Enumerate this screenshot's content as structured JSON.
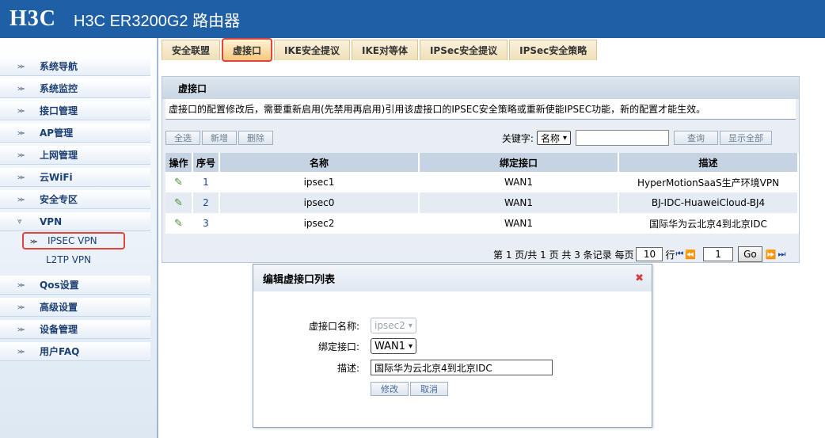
{
  "header": {
    "logo": "H3C",
    "title": "H3C ER3200G2 路由器"
  },
  "sidebar": {
    "items": [
      {
        "label": "系统导航"
      },
      {
        "label": "系统监控"
      },
      {
        "label": "接口管理"
      },
      {
        "label": "AP管理"
      },
      {
        "label": "上网管理"
      },
      {
        "label": "云WiFi"
      },
      {
        "label": "安全专区"
      },
      {
        "label": "VPN"
      },
      {
        "label": "Qos设置"
      },
      {
        "label": "高级设置"
      },
      {
        "label": "设备管理"
      },
      {
        "label": "用户FAQ"
      }
    ],
    "vpn_sub": [
      {
        "label": "IPSEC VPN"
      },
      {
        "label": "L2TP VPN"
      }
    ]
  },
  "tabs": [
    {
      "label": "安全联盟"
    },
    {
      "label": "虚接口"
    },
    {
      "label": "IKE安全提议"
    },
    {
      "label": "IKE对等体"
    },
    {
      "label": "IPSec安全提议"
    },
    {
      "label": "IPSec安全策略"
    }
  ],
  "panel": {
    "title": "虚接口",
    "notice": "虚接口的配置修改后，需要重新启用(先禁用再启用)引用该虚接口的IPSEC安全策略或重新使能IPSEC功能，新的配置才能生效。",
    "toolbar": {
      "select_all": "全选",
      "add": "新增",
      "delete": "删除",
      "keyword_label": "关键字:",
      "keyword_field": "名称",
      "query": "查询",
      "show_all": "显示全部"
    },
    "table": {
      "headers": [
        "操作",
        "序号",
        "名称",
        "绑定接口",
        "描述"
      ],
      "rows": [
        {
          "seq": "1",
          "name": "ipsec1",
          "iface": "WAN1",
          "desc": "HyperMotionSaaS生产环境VPN"
        },
        {
          "seq": "2",
          "name": "ipsec0",
          "iface": "WAN1",
          "desc": "BJ-IDC-HuaweiCloud-BJ4"
        },
        {
          "seq": "3",
          "name": "ipsec2",
          "iface": "WAN1",
          "desc": "国际华为云北京4到北京IDC"
        }
      ]
    },
    "pager": {
      "text1": "第 1 页/共 1 页 共 3 条记录 每页",
      "per_page": "10",
      "text2": "行",
      "page": "1",
      "go": "Go"
    }
  },
  "dialog": {
    "title": "编辑虚接口列表",
    "close": "✖",
    "name_label": "虚接口名称:",
    "name_value": "ipsec2",
    "iface_label": "绑定接口:",
    "iface_value": "WAN1",
    "desc_label": "描述:",
    "desc_value": "国际华为云北京4到北京IDC",
    "modify": "修改",
    "cancel": "取消"
  }
}
